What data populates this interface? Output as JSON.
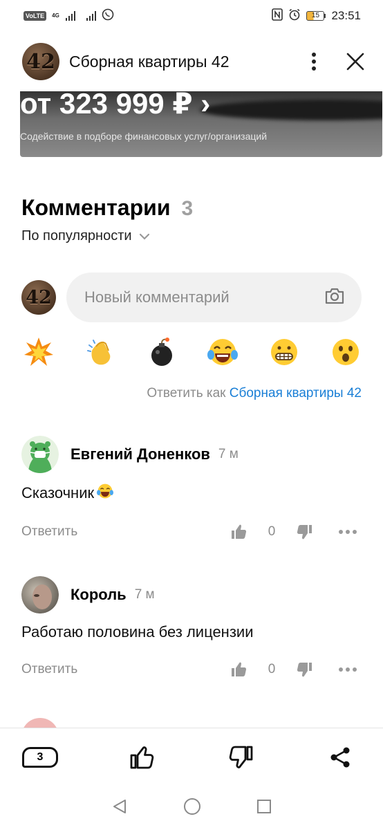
{
  "status_bar": {
    "volte": "VoLTE",
    "net": "4G",
    "time": "23:51",
    "battery": "15",
    "battery_color": "#f2b53d"
  },
  "header": {
    "avatar_text": "42",
    "title": "Сборная квартиры 42",
    "menu_icon": "kebab-icon",
    "close_icon": "close-icon"
  },
  "promo": {
    "price": "от 323 999 ₽ ›",
    "note": "Содействие в подборе финансовых услуг/организаций"
  },
  "comments": {
    "title": "Комментарии",
    "count": "3",
    "sort_label": "По популярности",
    "input_placeholder": "Новый комментарий",
    "reactions": [
      "collision",
      "clapping-hands",
      "bomb",
      "tears-of-joy",
      "grimacing",
      "astonished"
    ],
    "reply_as_prefix": "Ответить как",
    "reply_as_name": "Сборная квартиры 42",
    "link_color": "#1a7fd6",
    "items": [
      {
        "author": "Евгений Доненков",
        "time": "7 м",
        "text": "Сказочник",
        "emoji": "tears-of-joy",
        "reply_label": "Ответить",
        "score": "0"
      },
      {
        "author": "Король",
        "time": "7 м",
        "text": "Работаю половина без лицензии",
        "reply_label": "Ответить",
        "score": "0"
      }
    ]
  },
  "bottom_bar": {
    "comments_count": "3"
  }
}
